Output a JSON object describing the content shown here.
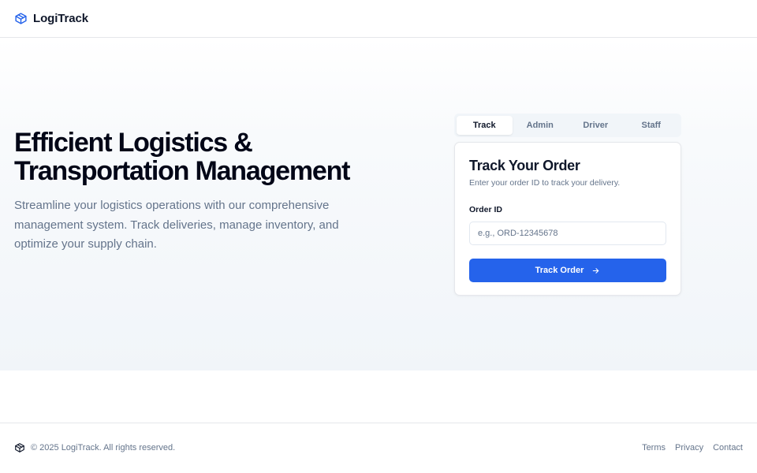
{
  "header": {
    "brand_name": "LogiTrack",
    "brand_icon": "package-icon"
  },
  "hero": {
    "title": "Efficient Logistics & Transportation Management",
    "subtitle": "Streamline your logistics operations with our comprehensive management system. Track deliveries, manage inventory, and optimize your supply chain."
  },
  "tabs": [
    {
      "label": "Track",
      "active": true
    },
    {
      "label": "Admin",
      "active": false
    },
    {
      "label": "Driver",
      "active": false
    },
    {
      "label": "Staff",
      "active": false
    }
  ],
  "track_card": {
    "title": "Track Your Order",
    "description": "Enter your order ID to track your delivery.",
    "order_id_label": "Order ID",
    "order_id_value": "",
    "order_id_placeholder": "e.g., ORD-12345678",
    "button_label": "Track Order",
    "button_icon": "arrow-right-icon"
  },
  "footer": {
    "copyright": "© 2025 LogiTrack. All rights reserved.",
    "links": [
      "Terms",
      "Privacy",
      "Contact"
    ]
  },
  "colors": {
    "accent": "#2563eb",
    "text_primary": "#0f172a",
    "text_muted": "#64748b",
    "border": "#e5e7eb"
  }
}
